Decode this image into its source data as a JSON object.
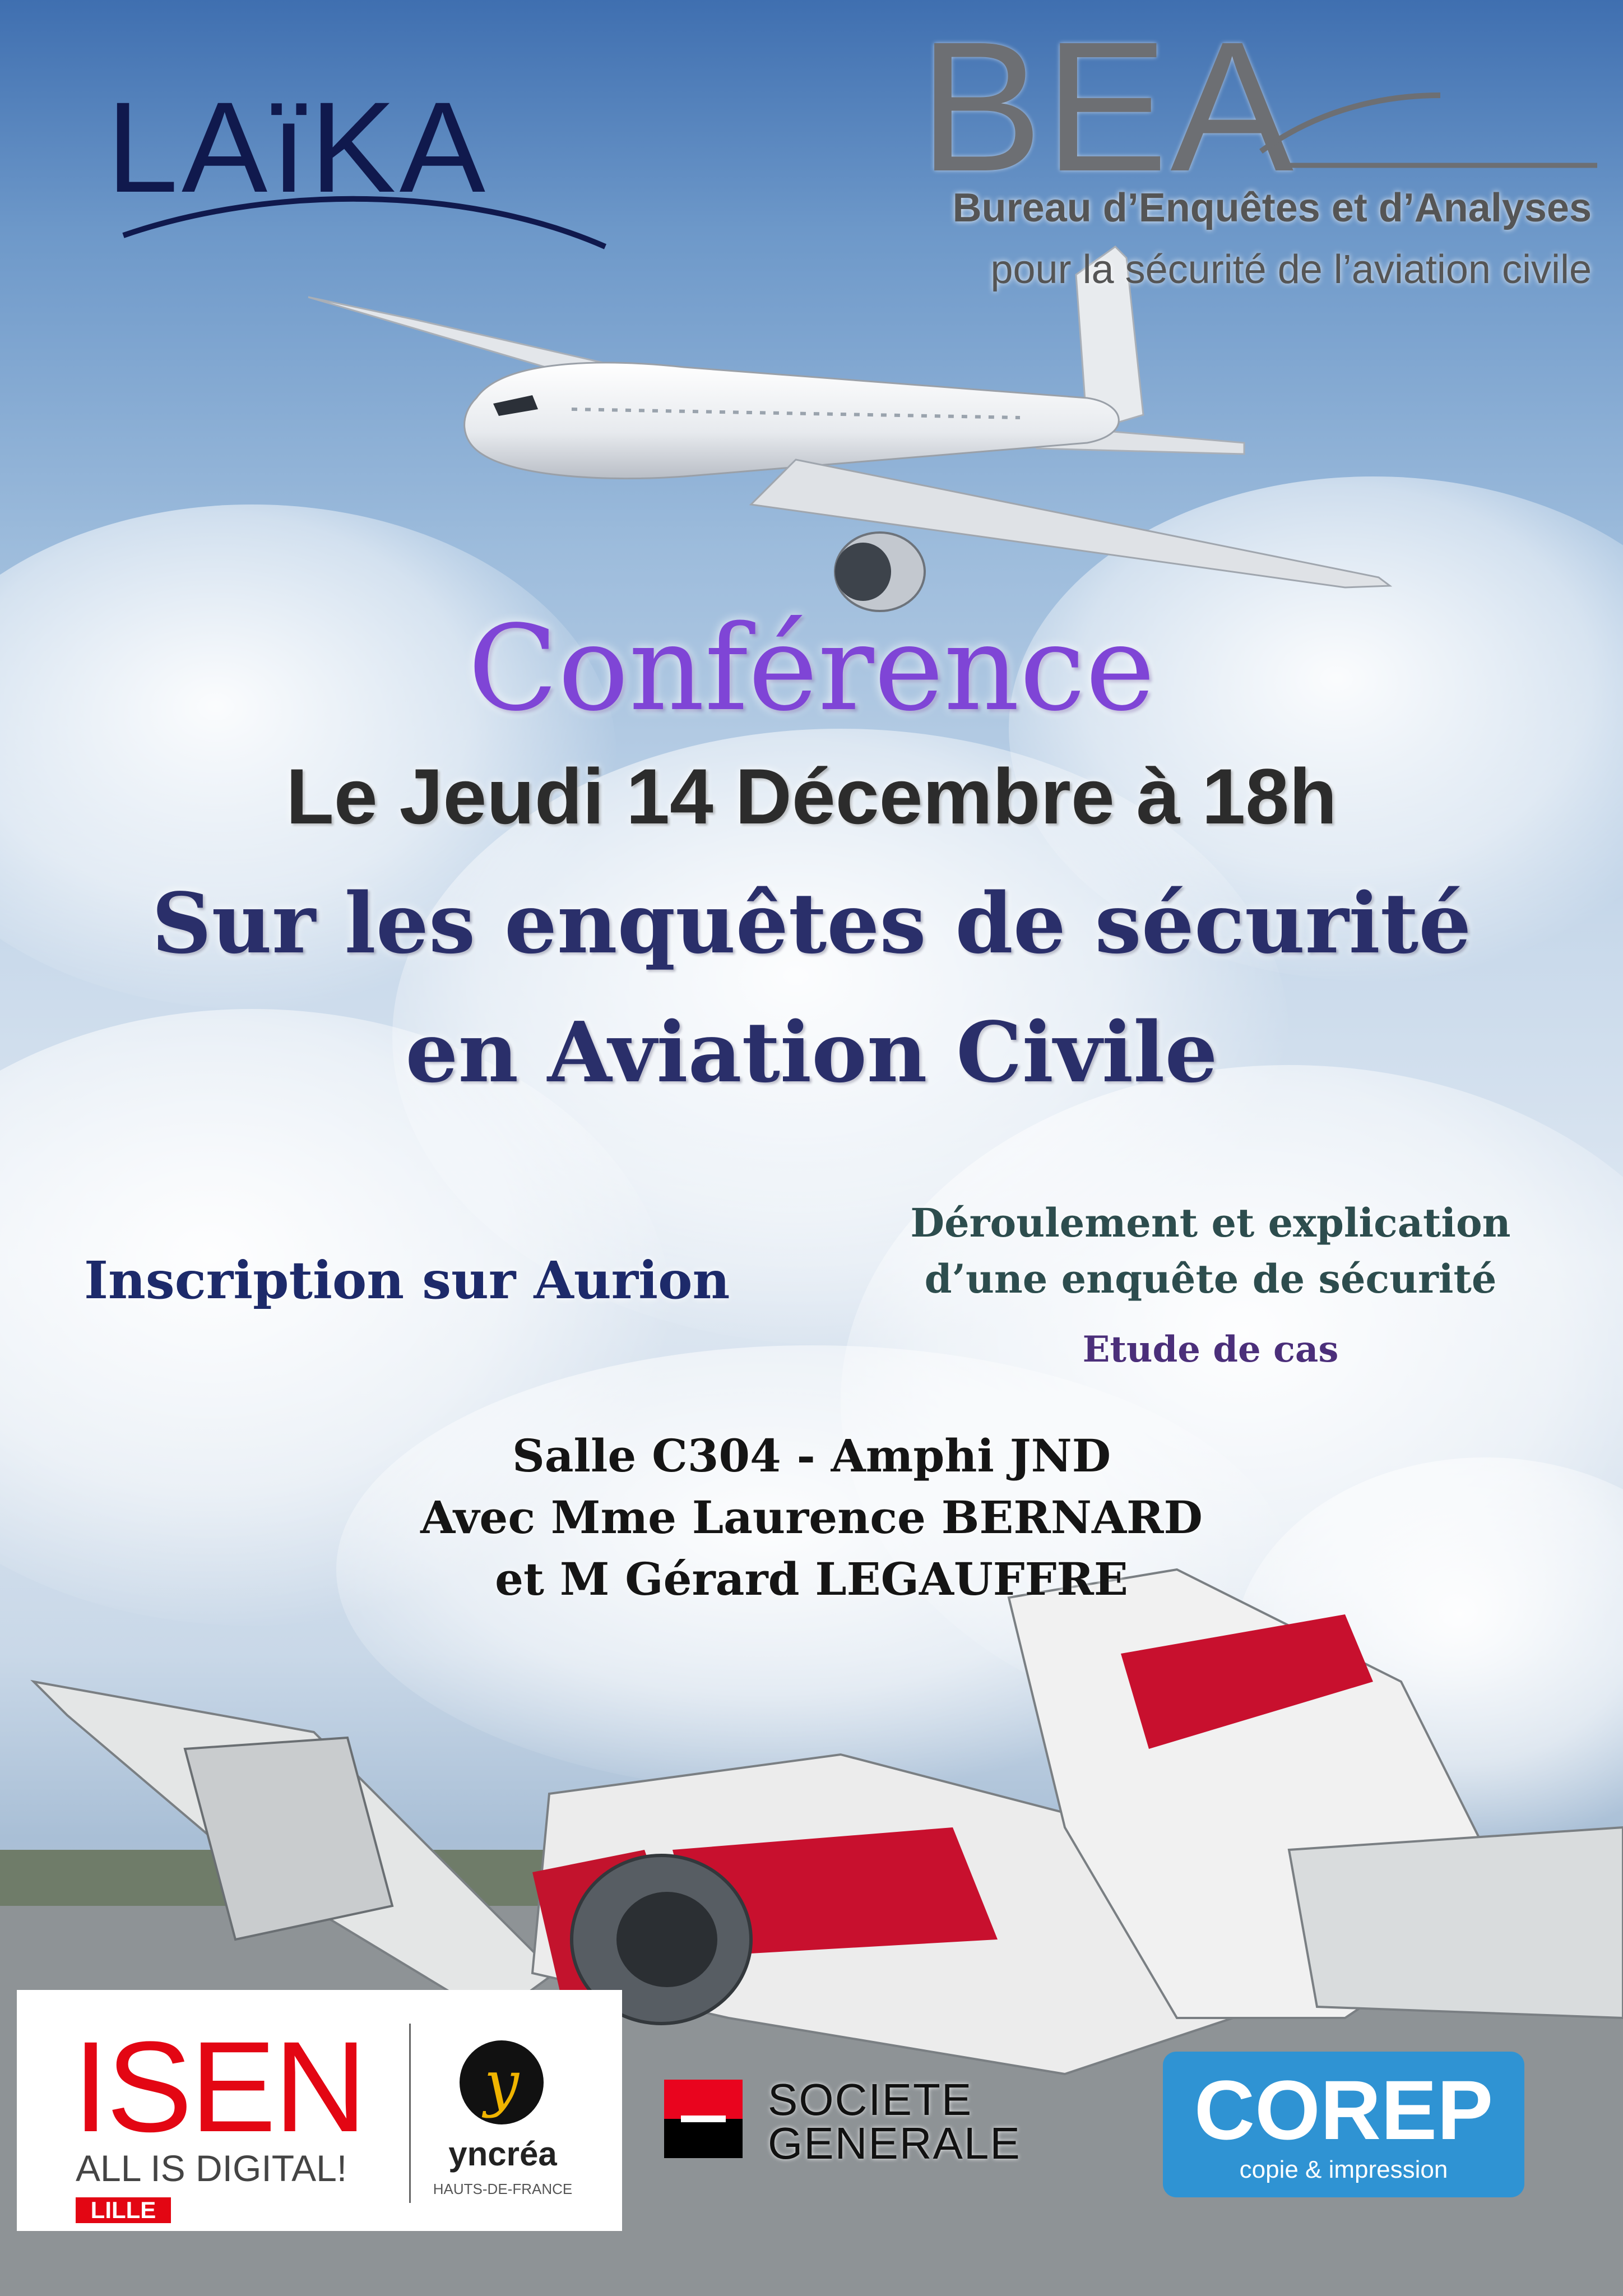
{
  "logos": {
    "laika": "LAïKA",
    "bea": {
      "letters": "BEA",
      "line1": "Bureau d’Enquêtes et d’Analyses",
      "line2": "pour la sécurité de l’aviation civile"
    }
  },
  "event": {
    "heading": "Conférence",
    "date_line": "Le Jeudi 14 Décembre à 18h",
    "subject_line1": "Sur les enquêtes de sécurité",
    "subject_line2": "en Aviation Civile",
    "registration": "Inscription sur Aurion",
    "topic_line1": "Déroulement et explication",
    "topic_line2": "d’une enquête de sécurité",
    "case_study": "Etude de cas",
    "venue": "Salle C304 - Amphi JND",
    "speaker_line1": "Avec Mme Laurence BERNARD",
    "speaker_line2": "et M Gérard LEGAUFFRE"
  },
  "sponsors": {
    "isen": {
      "name": "ISEN",
      "tagline": "ALL IS DIGITAL!",
      "city": "LILLE"
    },
    "yncrea": {
      "name": "yncréa",
      "region": "HAUTS-DE-FRANCE"
    },
    "societe_generale": {
      "line1": "SOCIETE",
      "line2": "GENERALE"
    },
    "corep": {
      "name": "COREP",
      "tagline": "copie & impression"
    }
  },
  "colors": {
    "heading": "#7f45d6",
    "subject": "#2a2f6a",
    "isen_red": "#e30613",
    "corep_blue": "#2f93d3",
    "sg_red": "#e9041e"
  }
}
